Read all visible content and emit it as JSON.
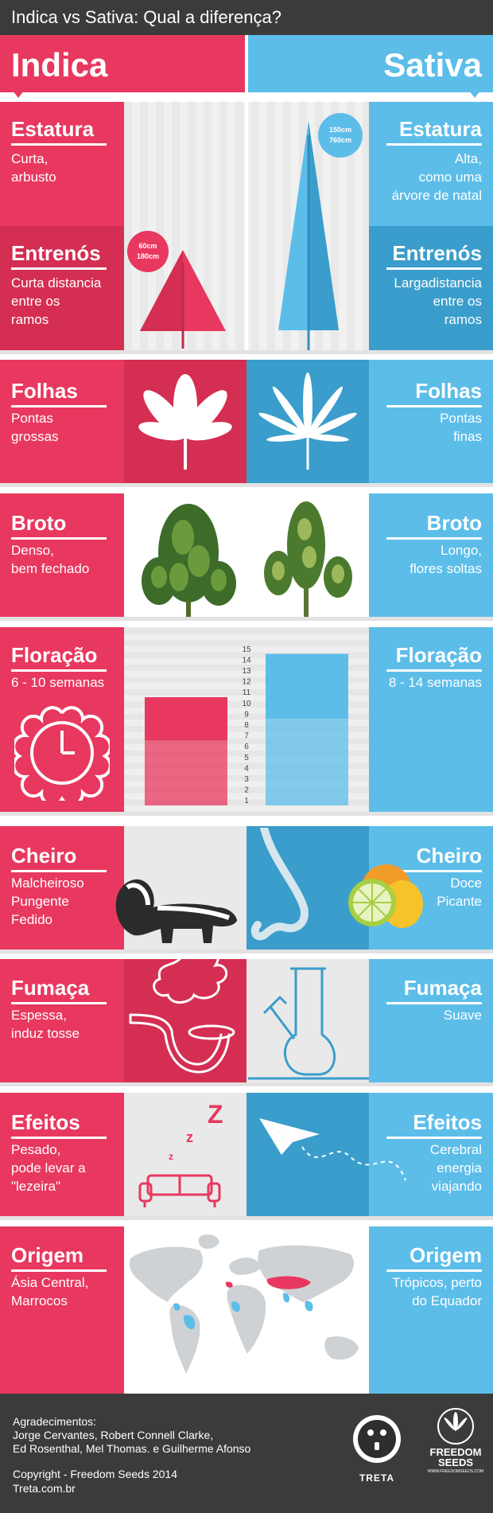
{
  "header": {
    "title": "Indica vs Sativa: Qual a diferença?"
  },
  "banner": {
    "left": "Indica",
    "right": "Sativa"
  },
  "estatura": {
    "title": "Estatura",
    "indica": "Curta,\narbusto",
    "sativa": "Alta,\ncomo uma\nárvore de natal",
    "indica_badge": "60cm\n180cm",
    "sativa_badge": "150cm\n760cm"
  },
  "entrenos": {
    "title": "Entrenós",
    "indica": "Curta distancia\nentre os\nramos",
    "sativa": "Largadistancia\nentre os\nramos"
  },
  "folhas": {
    "title": "Folhas",
    "indica": "Pontas\ngrossas",
    "sativa": "Pontas\nfinas"
  },
  "broto": {
    "title": "Broto",
    "indica": "Denso,\nbem fechado",
    "sativa": "Longo,\nflores soltas"
  },
  "floracao": {
    "title": "Floração",
    "indica": "6 - 10 semanas",
    "sativa": "8 - 14 semanas",
    "scale": [
      "15",
      "14",
      "13",
      "12",
      "11",
      "10",
      "9",
      "8",
      "7",
      "6",
      "5",
      "4",
      "3",
      "2",
      "1"
    ]
  },
  "chart_data": {
    "type": "bar",
    "categories": [
      "Indica",
      "Sativa"
    ],
    "series": [
      {
        "values": [
          6,
          8
        ]
      },
      {
        "values": [
          10,
          14
        ]
      }
    ],
    "ylim": [
      0,
      15
    ],
    "colors": [
      "#e8385f",
      "#5cbde9"
    ]
  },
  "cheiro": {
    "title": "Cheiro",
    "indica": "Malcheiroso\nPungente\nFedido",
    "sativa": "Doce\nPicante"
  },
  "fumaca": {
    "title": "Fumaça",
    "indica": "Espessa,\ninduz tosse",
    "sativa": "Suave"
  },
  "efeitos": {
    "title": "Efeitos",
    "indica": "Pesado,\npode levar a\n\"lezeira\"",
    "sativa": "Cerebral\nenergia\nviajando"
  },
  "origem": {
    "title": "Origem",
    "indica": "Ásia Central,\nMarrocos",
    "sativa": "Trópicos, perto\ndo Equador"
  },
  "footer": {
    "thanks": "Agradecimentos:\nJorge Cervantes, Robert Connell Clarke,\nEd Rosenthal, Mel Thomas. e Guilherme Afonso",
    "copyright": "Copyright - Freedom Seeds 2014",
    "site": "Treta.com.br",
    "treta_logo": "TRETA",
    "freedom_logo": "FREEDOM\nSEEDS",
    "freedom_url": "WWW.FREEDOMSEEDS.COM"
  },
  "colors": {
    "indica": "#e8385f",
    "sativa": "#5cbde9",
    "dark": "#3b3b3b"
  }
}
